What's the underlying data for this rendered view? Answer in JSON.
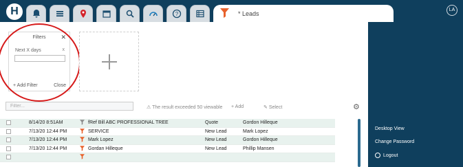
{
  "header": {
    "logo": "H",
    "tabs": [
      {
        "name": "bell-icon"
      },
      {
        "name": "menu-icon"
      },
      {
        "name": "map-pin-icon"
      },
      {
        "name": "calendar-icon"
      },
      {
        "name": "search-icon"
      },
      {
        "name": "gauge-icon"
      },
      {
        "name": "help-icon"
      },
      {
        "name": "list-icon"
      }
    ],
    "active_tab": {
      "icon": "funnel-icon",
      "label": "* Leads"
    },
    "user_initials": "LA"
  },
  "filters_panel": {
    "title": "Filters",
    "close_glyph": "✕",
    "field_label": "Next X days",
    "field_remove": "x",
    "field_value": "",
    "add_filter": "+ Add Filter",
    "close": "Close"
  },
  "toolbar": {
    "filter_placeholder": "Filter...",
    "result_message": "The result exceeded 50 viewable",
    "add": "+ Add",
    "select": "Select"
  },
  "rows": [
    {
      "date": "8/14/20 8:51AM",
      "name": "fRef Bill ABC PROFESSIONAL TREE",
      "status": "Quote",
      "owner": "Gordon Hilleque"
    },
    {
      "date": "7/13/20 12:44 PM",
      "name": "SERVICE",
      "status": "New Lead",
      "owner": "Mark Lopez"
    },
    {
      "date": "7/13/20 12:44 PM",
      "name": "Mark Lopez",
      "status": "New Lead",
      "owner": "Gordon Hilleque"
    },
    {
      "date": "7/13/20 12:44 PM",
      "name": "Gordan Hilleque",
      "status": "New Lead",
      "owner": "Phillip Mansen"
    },
    {
      "date": "",
      "name": "",
      "status": "",
      "owner": ""
    }
  ],
  "sidebar": {
    "desktop_view": "Desktop View",
    "change_password": "Change Password",
    "logout": "Logout"
  },
  "colors": {
    "nav": "#0f3f5d",
    "accent": "#e8622c",
    "row_alt": "#e8f2ee",
    "highlight": "#d61a1a"
  }
}
